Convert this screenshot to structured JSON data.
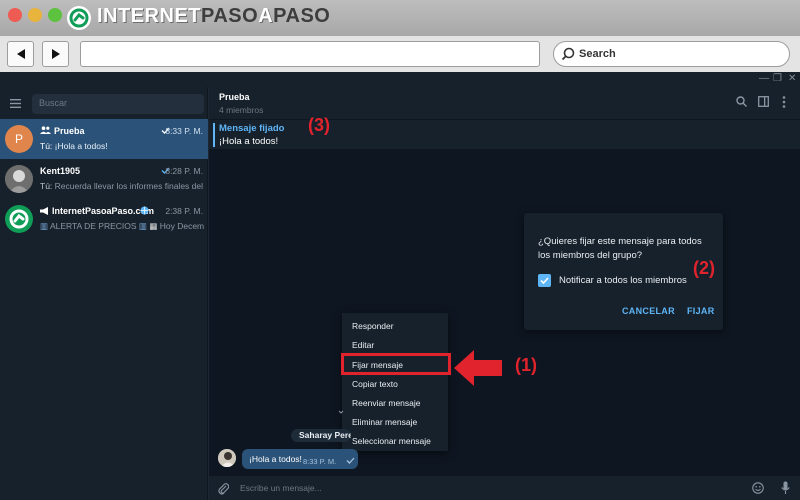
{
  "browser": {
    "logo": {
      "word1": "INTERNET",
      "word2": "PASO",
      "word3": "A",
      "word4": "PASO"
    },
    "search_label": "Search"
  },
  "sidebar": {
    "search_placeholder": "Buscar",
    "chats": [
      {
        "avatar_letter": "P",
        "name": "Prueba",
        "time": "8:33 P. M.",
        "sender": "Tú: ",
        "preview": "¡Hola a todos!",
        "active": true
      },
      {
        "name": "Kent1905",
        "time": "8:28 P. M.",
        "sender": "Tú: ",
        "preview": "Recuerda llevar los informes finales del pr...",
        "active": false
      },
      {
        "name": "InternetPasoaPaso.com",
        "time": "2:38 P. M.",
        "preview": "ALERTA DE PRECIOS",
        "preview2": "Hoy December...",
        "active": false
      }
    ]
  },
  "chat": {
    "title": "Prueba",
    "subtitle": "4 miembros",
    "pinned_title": "Mensaje fijado",
    "pinned_text": "¡Hola a todos!",
    "sender_pill": "Saharay Perez",
    "message_text": "¡Hola a todos!",
    "message_time": "8:33 P. M.",
    "composer_placeholder": "Escribe un mensaje..."
  },
  "dialog": {
    "question": "¿Quieres fijar este mensaje para todos los miembros del grupo?",
    "checkbox_label": "Notificar a todos los miembros",
    "checkbox_checked": true,
    "cancel_label": "CANCELAR",
    "confirm_label": "FIJAR"
  },
  "context_menu": {
    "items": [
      "Responder",
      "Editar",
      "Fijar mensaje",
      "Copiar texto",
      "Reenviar mensaje",
      "Eliminar mensaje",
      "Seleccionar mensaje"
    ],
    "highlighted_index": 2
  },
  "annotations": {
    "a1": "(1)",
    "a2": "(2)",
    "a3": "(3)"
  },
  "colors": {
    "accent": "#5eb5f7",
    "active_chat": "#2b5278",
    "annotation": "#e0232c"
  }
}
